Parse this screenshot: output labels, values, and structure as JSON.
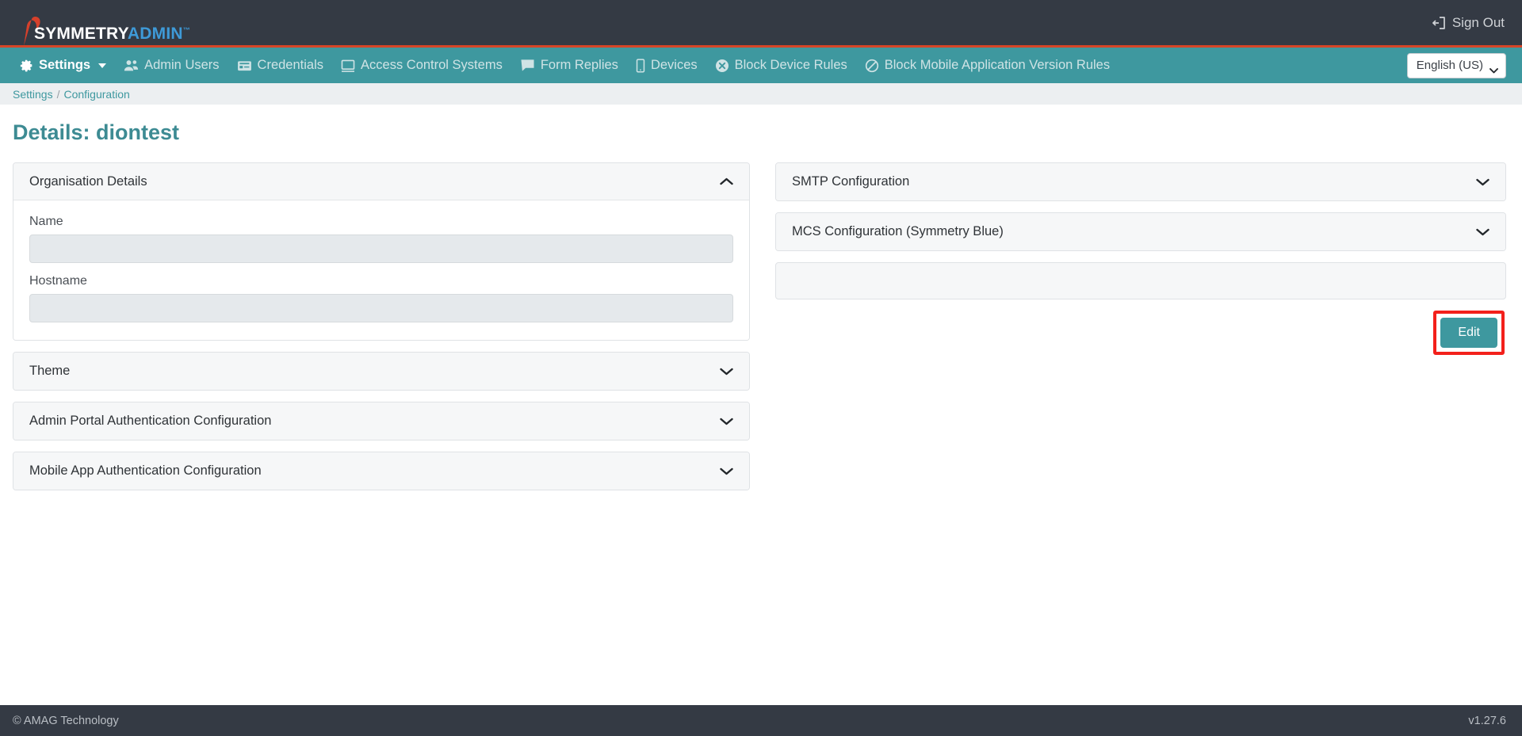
{
  "header": {
    "logo": {
      "part1": "SYMMETRY",
      "part2": "ADMIN",
      "trademark": "™",
      "mark_color": "#d6402b"
    },
    "sign_out": "Sign Out"
  },
  "nav": {
    "items": [
      {
        "label": "Settings",
        "icon": "gear-icon",
        "active": true,
        "has_caret": true
      },
      {
        "label": "Admin Users",
        "icon": "users-icon",
        "active": false,
        "has_caret": false
      },
      {
        "label": "Credentials",
        "icon": "card-icon",
        "active": false,
        "has_caret": false
      },
      {
        "label": "Access Control Systems",
        "icon": "monitor-icon",
        "active": false,
        "has_caret": false
      },
      {
        "label": "Form Replies",
        "icon": "comment-icon",
        "active": false,
        "has_caret": false
      },
      {
        "label": "Devices",
        "icon": "mobile-icon",
        "active": false,
        "has_caret": false
      },
      {
        "label": "Block Device Rules",
        "icon": "times-circle-icon",
        "active": false,
        "has_caret": false
      },
      {
        "label": "Block Mobile Application Version Rules",
        "icon": "ban-icon",
        "active": false,
        "has_caret": false
      }
    ],
    "language": {
      "selected": "English (US)",
      "options": [
        "English (US)"
      ]
    }
  },
  "breadcrumb": {
    "items": [
      "Settings",
      "Configuration"
    ],
    "separator": "/"
  },
  "page": {
    "title": "Details: diontest"
  },
  "left_panels": {
    "organisation_details": {
      "title": "Organisation Details",
      "expanded": true,
      "fields": [
        {
          "label": "Name",
          "value": "",
          "placeholder": ""
        },
        {
          "label": "Hostname",
          "value": "",
          "placeholder": ""
        }
      ]
    },
    "collapsed": [
      {
        "title": "Theme"
      },
      {
        "title": "Admin Portal Authentication Configuration"
      },
      {
        "title": "Mobile App Authentication Configuration"
      }
    ]
  },
  "right_panels": {
    "collapsed": [
      {
        "title": "SMTP Configuration"
      },
      {
        "title": "MCS Configuration (Symmetry Blue)"
      }
    ],
    "blank_panel": "",
    "edit_button": "Edit",
    "annotation_color": "#f3201b"
  },
  "footer": {
    "copyright": "© AMAG Technology",
    "version": "v1.27.6"
  },
  "theme": {
    "teal": "#3e989f",
    "dark": "#343a44",
    "accent_red": "#d64527"
  }
}
